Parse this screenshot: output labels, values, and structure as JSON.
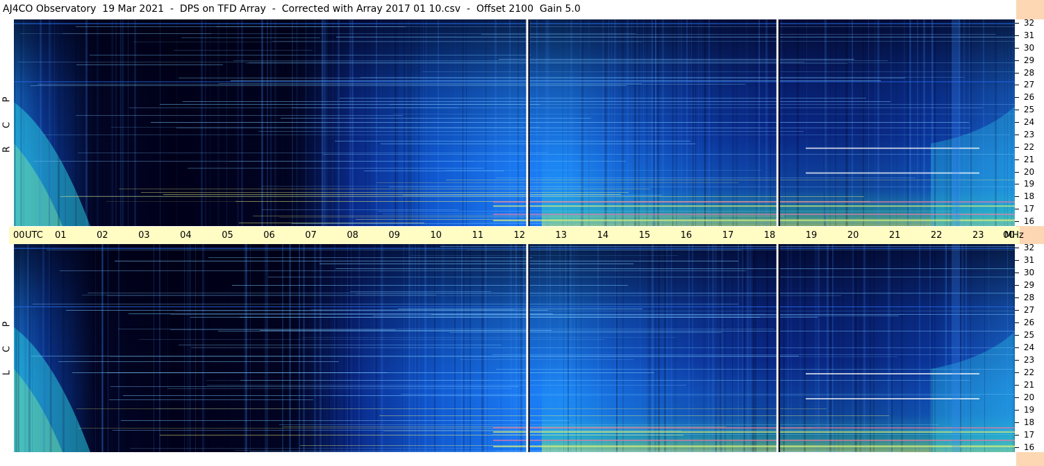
{
  "title": "AJ4CO Observatory  19 Mar 2021  -  DPS on TFD Array  -  Corrected with Array 2017 01 10.csv  -  Offset 2100  Gain 5.0",
  "panels": {
    "top_label": [
      "R",
      "C",
      "P"
    ],
    "bottom_label": [
      "L",
      "C",
      "P"
    ]
  },
  "colors": {
    "dark": "#00001a",
    "mid_blue": "#0a48d8",
    "bright_blue": "#1e8cff",
    "cyan": "#2ad8e8",
    "yellow": "#e8f060",
    "time_bar": "#fffcc4",
    "right_strip": "#fdd7b4"
  },
  "chart_data": {
    "type": "heatmap",
    "title": "AJ4CO Observatory  19 Mar 2021  -  DPS on TFD Array  -  Corrected with Array 2017 01 10.csv  -  Offset 2100  Gain 5.0",
    "x_ticks": [
      "00",
      "01",
      "02",
      "03",
      "04",
      "05",
      "06",
      "07",
      "08",
      "09",
      "10",
      "11",
      "12",
      "13",
      "14",
      "15",
      "16",
      "17",
      "18",
      "19",
      "20",
      "21",
      "22",
      "23",
      "00"
    ],
    "x_unit_label": "UTC",
    "y_unit_label": "MHz",
    "xlim_hours": [
      0,
      24
    ],
    "ylim_mhz": [
      16,
      32
    ],
    "y_ticks": [
      "32",
      "31",
      "30",
      "29",
      "28",
      "27",
      "26",
      "25",
      "24",
      "23",
      "22",
      "21",
      "20",
      "19",
      "18",
      "17",
      "16"
    ],
    "panels": [
      "RCP",
      "LCP"
    ],
    "calibration_lines_utc_hours": [
      12.3,
      18.3
    ],
    "horizontal_line_mhz": [
      31.7,
      27.2
    ]
  }
}
